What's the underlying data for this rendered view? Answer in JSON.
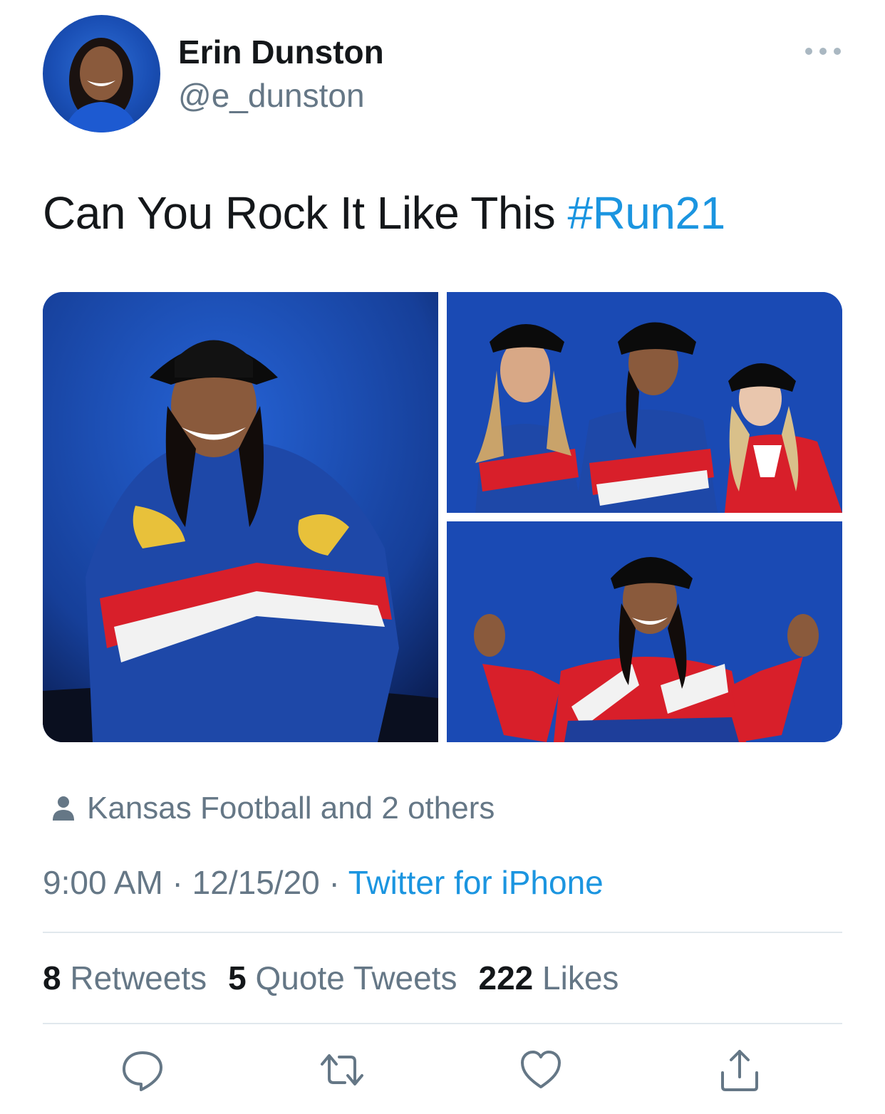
{
  "tweet": {
    "author": {
      "display_name": "Erin Dunston",
      "handle": "@e_dunston"
    },
    "text": "Can You Rock It Like This ",
    "hashtag": "#Run21",
    "media": [
      {
        "description": "Woman in black bucket hat and Kansas Jayhawks windbreaker crouching"
      },
      {
        "description": "Three women in black bucket hats and Kansas jackets"
      },
      {
        "description": "Woman in black bucket hat and red KU jacket with raised hands"
      }
    ],
    "tagged": "Kansas Football and 2 others",
    "meta": {
      "time": "9:00 AM",
      "sep1": " · ",
      "date": "12/15/20",
      "sep2": " · ",
      "source": "Twitter for iPhone"
    },
    "stats": {
      "retweets_count": "8",
      "retweets_label": " Retweets",
      "quotes_count": "5",
      "quotes_label": " Quote Tweets",
      "likes_count": "222",
      "likes_label": " Likes"
    }
  },
  "icons": {
    "more": "more-icon",
    "person": "person-icon",
    "reply": "reply-icon",
    "retweet": "retweet-icon",
    "like": "heart-icon",
    "share": "share-icon"
  },
  "colors": {
    "link": "#1b95e0",
    "secondary_text": "#657786",
    "primary_text": "#14171a",
    "divider": "#e1e8ed",
    "photo_backdrop": "#1c4fb8"
  }
}
